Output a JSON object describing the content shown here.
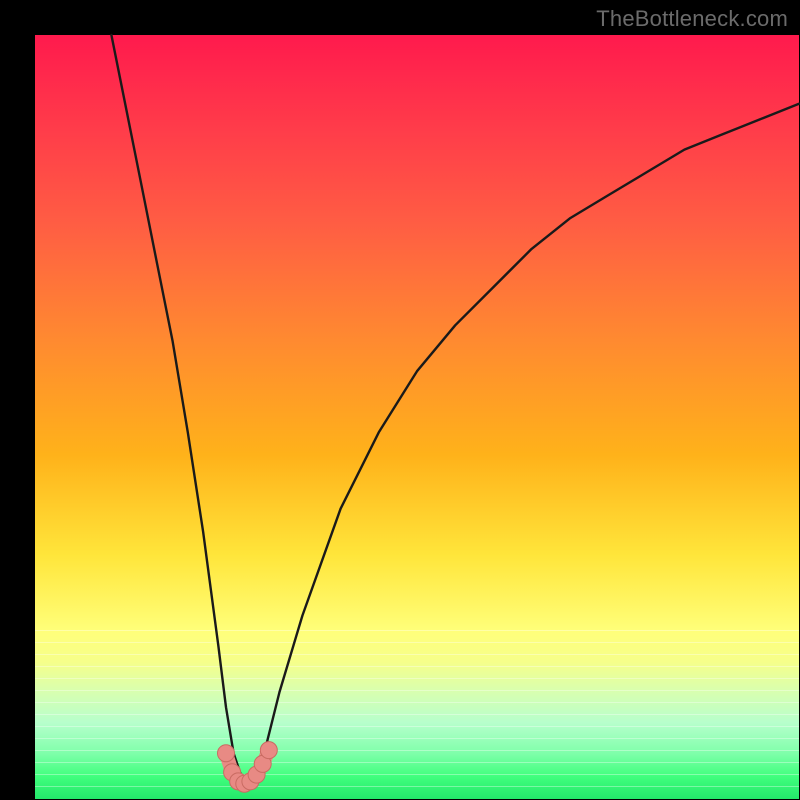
{
  "watermark": "TheBottleneck.com",
  "colors": {
    "frame": "#000000",
    "gradient_top": "#ff1a4d",
    "gradient_bottom": "#23e86a",
    "curve_stroke": "#1a1a1a",
    "marker_fill": "#e88a84",
    "marker_stroke": "#c96b62"
  },
  "chart_data": {
    "type": "line",
    "title": "",
    "xlabel": "",
    "ylabel": "",
    "xlim": [
      0,
      100
    ],
    "ylim": [
      0,
      100
    ],
    "grid": false,
    "legend": false,
    "series": [
      {
        "name": "bottleneck-curve",
        "x": [
          10,
          12,
          14,
          16,
          18,
          20,
          22,
          24,
          25,
          26,
          27,
          28,
          29,
          30,
          32,
          35,
          40,
          45,
          50,
          55,
          60,
          65,
          70,
          75,
          80,
          85,
          90,
          95,
          100
        ],
        "y": [
          100,
          90,
          80,
          70,
          60,
          48,
          35,
          20,
          12,
          6,
          3,
          2,
          3,
          6,
          14,
          24,
          38,
          48,
          56,
          62,
          67,
          72,
          76,
          79,
          82,
          85,
          87,
          89,
          91
        ]
      }
    ],
    "markers": {
      "name": "optimal-range",
      "x": [
        25.0,
        25.8,
        26.6,
        27.4,
        28.2,
        29.0,
        29.8,
        30.6
      ],
      "y": [
        6.0,
        3.5,
        2.3,
        2.0,
        2.3,
        3.2,
        4.6,
        6.4
      ]
    },
    "background_gradient": {
      "orientation": "vertical",
      "stops": [
        {
          "pos": 0.0,
          "color": "#ff1a4d"
        },
        {
          "pos": 0.25,
          "color": "#ff5e43"
        },
        {
          "pos": 0.55,
          "color": "#ffb21a"
        },
        {
          "pos": 0.78,
          "color": "#ffff7a"
        },
        {
          "pos": 1.0,
          "color": "#23e86a"
        }
      ]
    }
  }
}
